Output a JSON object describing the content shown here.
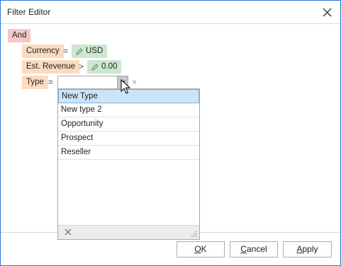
{
  "window": {
    "title": "Filter Editor"
  },
  "filter": {
    "group_operator": "And",
    "conditions": [
      {
        "field": "Currency",
        "operator": "=",
        "value": "USD"
      },
      {
        "field": "Est. Revenue",
        "operator": ">",
        "value": "0.00"
      },
      {
        "field": "Type",
        "operator": "=",
        "value": ""
      }
    ]
  },
  "dropdown": {
    "items": [
      "New Type",
      "New type 2",
      "Opportunity",
      "Prospect",
      "Reseller"
    ],
    "selected_index": 0,
    "clear_symbol": "×"
  },
  "buttons": {
    "ok": "OK",
    "cancel": "Cancel",
    "apply": "Apply"
  },
  "colors": {
    "group_chip": "#f5c7c7",
    "field_chip": "#fbdcbf",
    "value_chip": "#cde6cf",
    "selection": "#cce4f7",
    "window_border": "#2b79d6"
  },
  "icons": {
    "window_close": "close-icon",
    "value_edit": "pencil-icon",
    "dropdown": "chevron-down-icon",
    "popup_clear": "close-icon",
    "resize": "resize-grip-icon"
  }
}
